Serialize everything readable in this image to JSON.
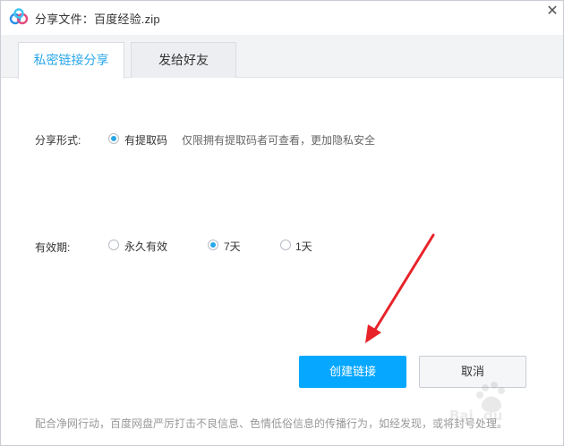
{
  "window": {
    "title": "分享文件：百度经验.zip",
    "close_glyph": "✕"
  },
  "tabs": [
    {
      "label": "私密链接分享",
      "active": true
    },
    {
      "label": "发给好友",
      "active": false
    }
  ],
  "share_form": {
    "label": "分享形式:",
    "option": "有提取码",
    "option_checked": true,
    "hint": "仅限拥有提取码者可查看，更加隐私安全"
  },
  "validity": {
    "label": "有效期:",
    "options": [
      {
        "label": "永久有效",
        "checked": false
      },
      {
        "label": "7天",
        "checked": true
      },
      {
        "label": "1天",
        "checked": false
      }
    ]
  },
  "buttons": {
    "create": "创建链接",
    "cancel": "取消"
  },
  "footer_note": "配合净网行动，百度网盘严厉打击不良信息、色情低俗信息的传播行为，如经发现，或将封号处理。",
  "colors": {
    "accent": "#06a7ff",
    "tab_active_text": "#2aa7e8",
    "annotation_arrow": "#e8232a"
  },
  "icons": {
    "app_logo": "baidu-netdisk-logo-icon",
    "close": "close-icon"
  }
}
